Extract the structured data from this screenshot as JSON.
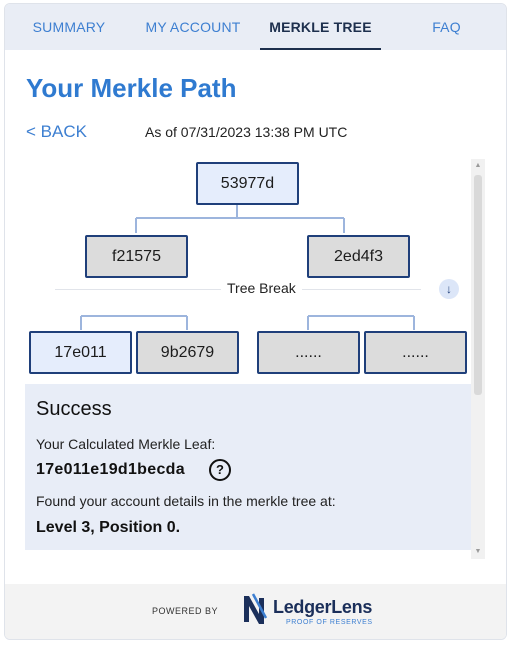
{
  "tabs": [
    {
      "label": "SUMMARY",
      "active": false
    },
    {
      "label": "MY ACCOUNT",
      "active": false
    },
    {
      "label": "MERKLE TREE",
      "active": true
    },
    {
      "label": "FAQ",
      "active": false
    }
  ],
  "page": {
    "title": "Your Merkle Path",
    "back_label": "< BACK",
    "as_of": "As of 07/31/2023 13:38 PM UTC"
  },
  "tree": {
    "root": "53977d",
    "level2": [
      "f21575",
      "2ed4f3"
    ],
    "break_label": "Tree Break",
    "level3": [
      "17e011",
      "9b2679",
      "......",
      "......"
    ]
  },
  "result": {
    "title": "Success",
    "leaf_label": "Your Calculated Merkle Leaf:",
    "leaf_value": "17e011e19d1becda",
    "help_icon": "?",
    "found_label": "Found your account details in the merkle tree at:",
    "position": "Level 3, Position 0."
  },
  "footer": {
    "powered_by": "POWERED BY",
    "brand": "LedgerLens",
    "tagline": "PROOF OF RESERVES"
  },
  "icons": {
    "expand": "arrow-down-icon",
    "help": "question-circle-icon",
    "logo": "ledgerlens-logo-icon"
  },
  "colors": {
    "accent": "#3d7fd1",
    "title": "#2f7ad0",
    "path_node": "#e5edfc",
    "sibling_node": "#dcdcdc",
    "node_border": "#1f3f7a",
    "success_bg": "#e8edf7",
    "tab_bar": "#e9edf5"
  }
}
